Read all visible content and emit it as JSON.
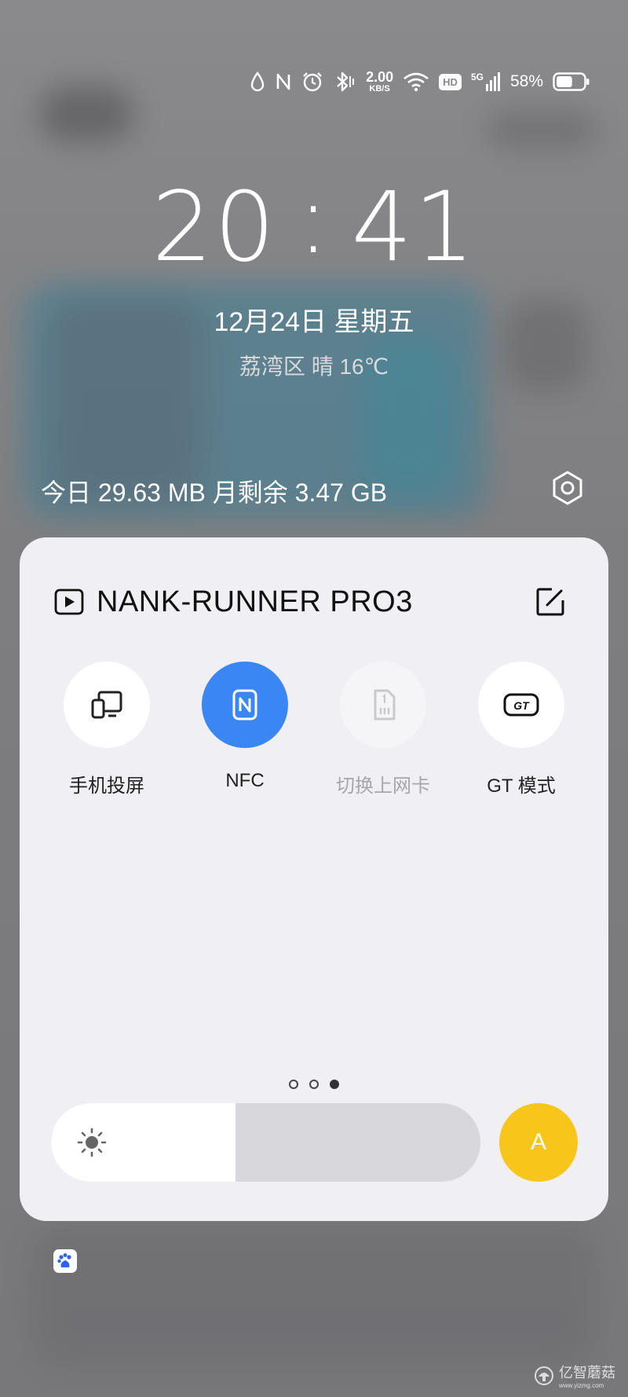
{
  "status_bar": {
    "speed_value": "2.00",
    "speed_unit": "KB/S",
    "hd_label": "HD",
    "network_label": "5G",
    "battery_percent": "58%",
    "battery_level": 0.58,
    "icons": [
      "drop-icon",
      "nfc-status-icon",
      "alarm-icon",
      "bluetooth-icon",
      "wifi-icon",
      "signal-icon",
      "battery-icon"
    ]
  },
  "clock": {
    "time": "20:41",
    "date": "12月24日  星期五",
    "weather": "荔湾区 晴 16℃"
  },
  "data_usage": {
    "text": "今日 29.63 MB 月剩余 3.47 GB"
  },
  "panel": {
    "media_title": "NANK-RUNNER PRO3",
    "tiles": [
      {
        "label": "手机投屏",
        "icon": "screen-cast-icon",
        "state": "off"
      },
      {
        "label": "NFC",
        "icon": "nfc-icon",
        "state": "on"
      },
      {
        "label": "切换上网卡",
        "icon": "sim-card-icon",
        "state": "disabled"
      },
      {
        "label": "GT 模式",
        "icon": "gt-mode-icon",
        "state": "off"
      }
    ],
    "page_count": 3,
    "active_page": 3,
    "brightness_level": 0.43,
    "auto_label": "A"
  },
  "colors": {
    "accent_blue": "#3a86f3",
    "auto_yellow": "#f8c51a",
    "panel_bg": "#efeff4"
  },
  "watermark": {
    "text": "亿智蘑菇",
    "sub": "www.yizmg.com"
  }
}
